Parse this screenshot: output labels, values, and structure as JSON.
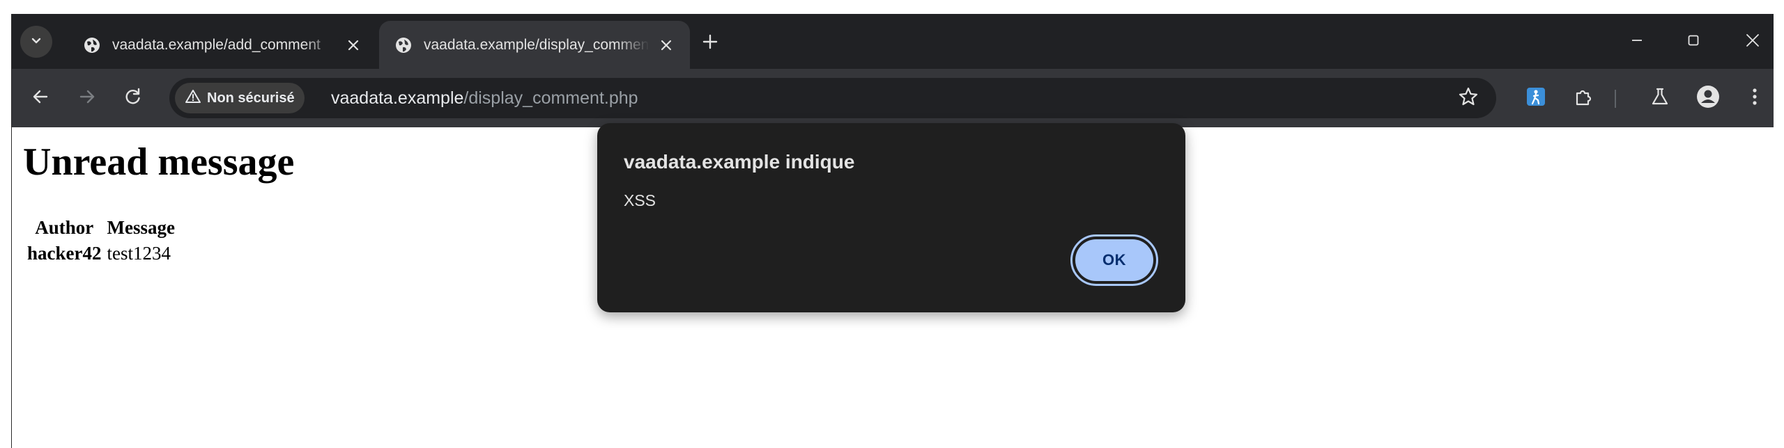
{
  "browser": {
    "tabs": [
      {
        "title": "vaadata.example/add_comment",
        "active": false
      },
      {
        "title": "vaadata.example/display_comment.php",
        "active": true
      }
    ],
    "address_bar": {
      "security_label": "Non sécurisé",
      "url_host": "vaadata.example",
      "url_path": "/display_comment.php"
    },
    "colors": {
      "tabstrip": "#202124",
      "toolbar": "#35363a",
      "accent": "#a8c7fa"
    }
  },
  "page": {
    "title": "Unread message",
    "table": {
      "headers": [
        "Author",
        "Message"
      ],
      "rows": [
        {
          "author": "hacker42",
          "message": "test1234"
        }
      ]
    }
  },
  "dialog": {
    "title": "vaadata.example indique",
    "message": "XSS",
    "ok_label": "OK"
  }
}
